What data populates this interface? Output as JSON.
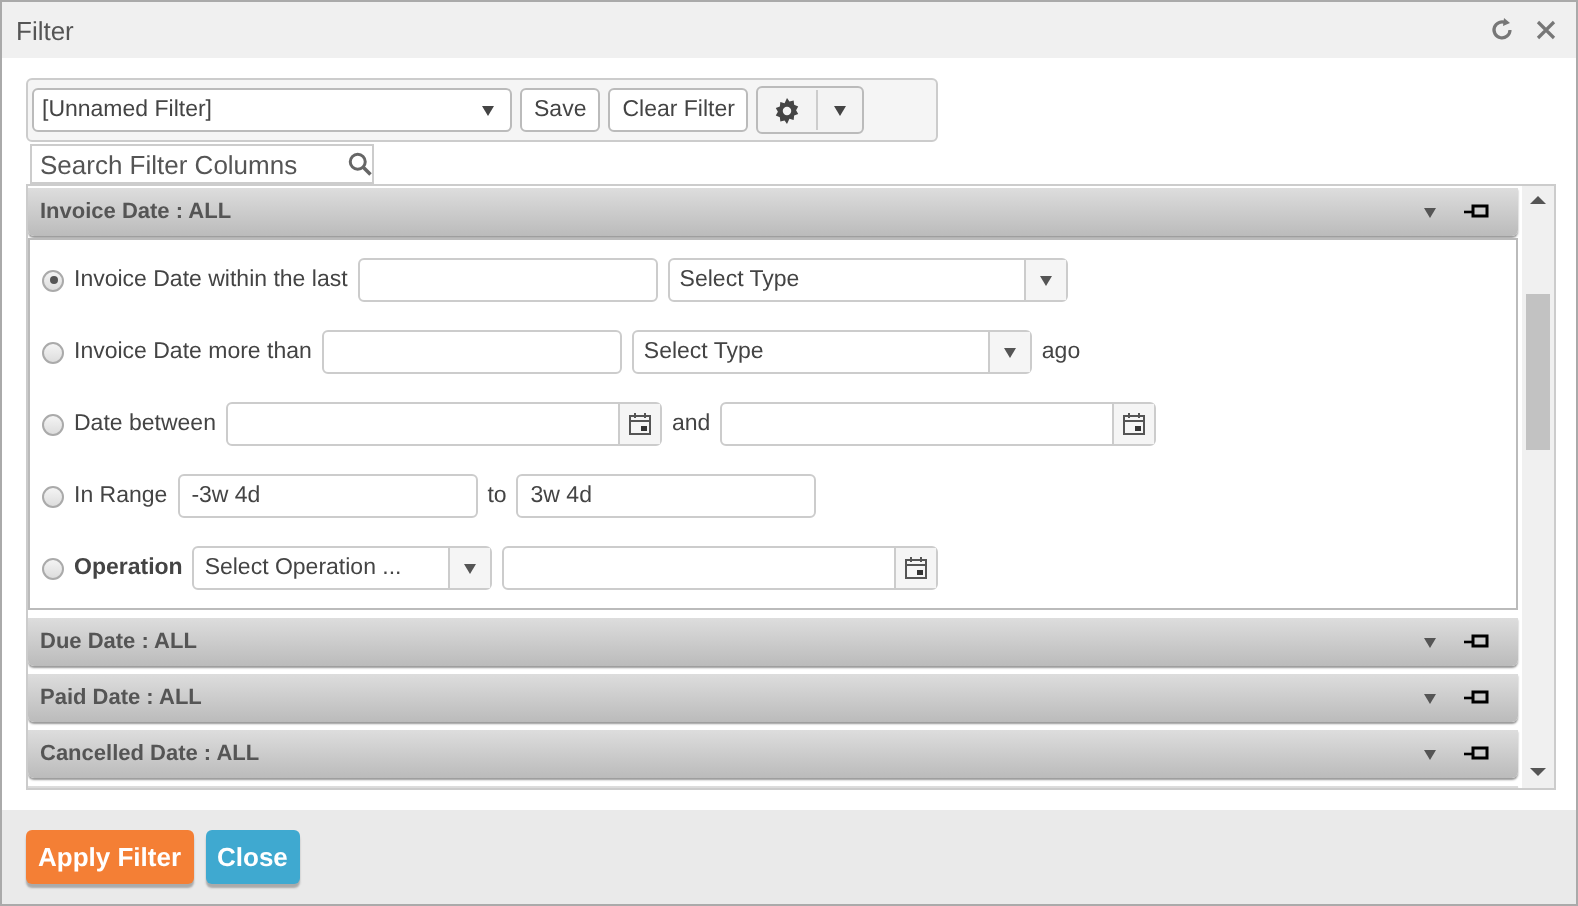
{
  "window": {
    "title": "Filter"
  },
  "toolbar": {
    "filter_select": "[Unnamed Filter]",
    "buttons": [
      "Save",
      "Clear Filter"
    ]
  },
  "search": {
    "placeholder": "Search Filter Columns"
  },
  "sections": [
    {
      "title": "Invoice Date : ALL",
      "rows": [
        {
          "label": "Invoice Date within the last",
          "bold": false,
          "selected": true,
          "controls": [
            {
              "kind": "input"
            },
            {
              "kind": "select",
              "value": "Select Type"
            }
          ]
        },
        {
          "label": "Invoice Date more than",
          "bold": false,
          "selected": false,
          "controls": [
            {
              "kind": "input"
            },
            {
              "kind": "select",
              "value": "Select Type"
            },
            {
              "kind": "text",
              "value": "ago"
            }
          ]
        },
        {
          "label": "Date between",
          "bold": false,
          "selected": false,
          "controls": [
            {
              "kind": "date"
            },
            {
              "kind": "text",
              "value": "and"
            },
            {
              "kind": "date"
            }
          ]
        },
        {
          "label": "In Range",
          "bold": false,
          "selected": false,
          "controls": [
            {
              "kind": "input",
              "value": "-3w 4d"
            },
            {
              "kind": "text",
              "value": "to"
            },
            {
              "kind": "input",
              "value": "3w 4d"
            }
          ]
        },
        {
          "label": "Operation",
          "bold": true,
          "selected": false,
          "controls": [
            {
              "kind": "combo",
              "value": "Select Operation ..."
            },
            {
              "kind": "date"
            }
          ]
        }
      ]
    },
    {
      "title": "Due Date : ALL"
    },
    {
      "title": "Paid Date : ALL"
    },
    {
      "title": "Cancelled Date : ALL"
    }
  ],
  "footer_buttons": [
    {
      "label": "Apply Filter",
      "kind": "primary"
    },
    {
      "label": "Close",
      "kind": "secondary"
    }
  ]
}
